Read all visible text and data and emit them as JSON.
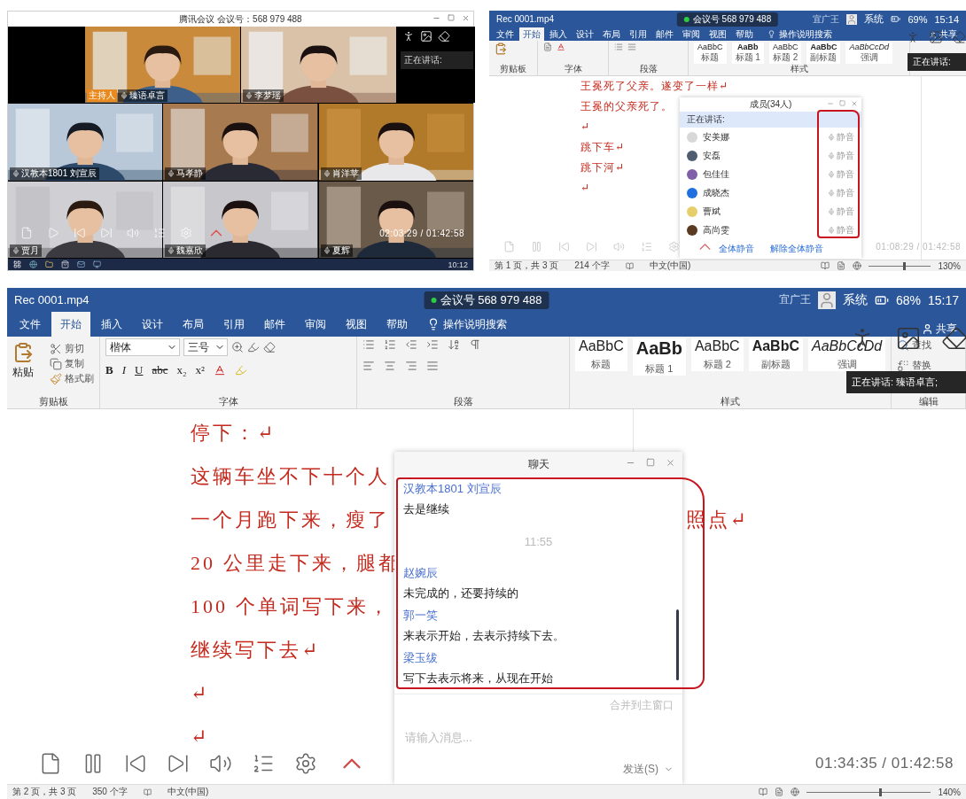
{
  "video_call": {
    "title": "腾讯会议 会议号：568 979 488",
    "side_label": "正在讲话:",
    "tiles": [
      {
        "name": "臻语卓言",
        "host_badge": "主持人"
      },
      {
        "name": "李梦瑶"
      },
      {
        "name": "汉教本1801 刘宣辰"
      },
      {
        "name": "马孝静"
      },
      {
        "name": "肖洋苹"
      },
      {
        "name": "贾月"
      },
      {
        "name": "魏嘉欣"
      },
      {
        "name": "夏辉"
      }
    ],
    "player": {
      "playing": false,
      "time": "02:03:29 / 01:42:58"
    },
    "taskbar_clock": "10:12"
  },
  "word_small": {
    "title_bar": {
      "file": "Rec 0001.mp4",
      "meeting": "会议号 568 979 488",
      "user": "宜广王",
      "system": "系统",
      "battery": "69%",
      "clock": "15:14"
    },
    "tabs": [
      {
        "label": "文件",
        "selected": false
      },
      {
        "label": "开始",
        "selected": true
      },
      {
        "label": "插入",
        "selected": false
      },
      {
        "label": "设计",
        "selected": false
      },
      {
        "label": "布局",
        "selected": false
      },
      {
        "label": "引用",
        "selected": false
      },
      {
        "label": "邮件",
        "selected": false
      },
      {
        "label": "审阅",
        "selected": false
      },
      {
        "label": "视图",
        "selected": false
      },
      {
        "label": "帮助",
        "selected": false
      }
    ],
    "search": "操作说明搜索",
    "share": "共享",
    "ribbon": [
      {
        "kind": "plain",
        "label": "剪贴板"
      },
      {
        "kind": "plain",
        "label": "字体"
      },
      {
        "kind": "plain",
        "label": "段落"
      },
      {
        "kind": "styles",
        "label": "样式",
        "styles": [
          {
            "sample": "AaBbC",
            "name": "标题",
            "kind": "regular"
          },
          {
            "sample": "AaBb",
            "name": "标题 1",
            "kind": "bold"
          },
          {
            "sample": "AaBbC",
            "name": "标题 2",
            "kind": "regular"
          },
          {
            "sample": "AaBbC",
            "name": "副标题",
            "kind": "bold"
          },
          {
            "sample": "AaBbCcDd",
            "name": "强调",
            "kind": "italic"
          }
        ]
      }
    ],
    "tooltip": "正在讲话:",
    "doc_lines": [
      {
        "text": "王冕死了父亲。遂变了一样↵"
      },
      {
        "text": "王冕的父亲死了。"
      },
      {
        "text": "↵"
      },
      {
        "text": "跳下车↵"
      },
      {
        "text": "跳下河↵"
      },
      {
        "text": "↵"
      }
    ],
    "members": {
      "title": "成员(34人)",
      "speaking_label": "正在讲话:",
      "list": [
        {
          "name": "安美娜",
          "status": "静音",
          "color": "#d8d8d8"
        },
        {
          "name": "安磊",
          "status": "静音",
          "color": "#4f5d70"
        },
        {
          "name": "包佳佳",
          "status": "静音",
          "color": "#8060a8"
        },
        {
          "name": "成晓杰",
          "status": "静音",
          "color": "#1f6fe0"
        },
        {
          "name": "曹斌",
          "status": "静音",
          "color": "#e6cf6a"
        },
        {
          "name": "高尚雯",
          "status": "静音",
          "color": "#5a3a20"
        }
      ],
      "buttons": [
        "全体静音",
        "解除全体静音"
      ]
    },
    "player": {
      "playing": true,
      "time": "01:08:29 / 01:42:58"
    },
    "status": {
      "page": "第 1 页，共 3 页",
      "words": "214 个字",
      "language": "中文(中国)",
      "zoom_slider": {
        "level": 0.55
      },
      "zoom": "130%"
    }
  },
  "word_large": {
    "title_bar": {
      "file": "Rec 0001.mp4",
      "meeting": "会议号 568 979 488",
      "user": "宜广王",
      "system": "系统",
      "battery": "68%",
      "clock": "15:17"
    },
    "tabs": [
      {
        "label": "文件",
        "selected": false
      },
      {
        "label": "开始",
        "selected": true
      },
      {
        "label": "插入",
        "selected": false
      },
      {
        "label": "设计",
        "selected": false
      },
      {
        "label": "布局",
        "selected": false
      },
      {
        "label": "引用",
        "selected": false
      },
      {
        "label": "邮件",
        "selected": false
      },
      {
        "label": "审阅",
        "selected": false
      },
      {
        "label": "视图",
        "selected": false
      },
      {
        "label": "帮助",
        "selected": false
      }
    ],
    "search": "操作说明搜索",
    "share": "共享",
    "ribbon": [
      {
        "kind": "clipboard",
        "label": "剪贴板",
        "paste": "粘贴",
        "items": [
          "剪切",
          "复制",
          "格式刷"
        ]
      },
      {
        "kind": "font",
        "label": "字体",
        "font": "楷体",
        "size": "三号",
        "buttons": [
          "B",
          "I",
          "U",
          "abc",
          "x₂",
          "x²"
        ]
      },
      {
        "kind": "paragraph",
        "label": "段落"
      },
      {
        "kind": "styles",
        "label": "样式",
        "styles": [
          {
            "sample": "AaBbC",
            "name": "标题",
            "kind": "regular"
          },
          {
            "sample": "AaBb",
            "name": "标题 1",
            "kind": "bold"
          },
          {
            "sample": "AaBbC",
            "name": "标题 2",
            "kind": "regular"
          },
          {
            "sample": "AaBbC",
            "name": "副标题",
            "kind": "bold"
          },
          {
            "sample": "AaBbCcDd",
            "name": "强调",
            "kind": "italic"
          }
        ]
      },
      {
        "kind": "editing",
        "label": "编辑",
        "items": [
          "查找",
          "替换"
        ]
      }
    ],
    "tooltip": "正在讲话: 臻语卓言;",
    "doc_lines": [
      {
        "text": "停下：↵"
      },
      {
        "text": "这辆车坐不下十个人"
      },
      {
        "text": "一个月跑下来，瘦了",
        "tail": "照点↵"
      },
      {
        "text": "20 公里走下来，腿都"
      },
      {
        "text": "100 个单词写下来，"
      },
      {
        "text": "继续写下去↵"
      },
      {
        "text": "↵"
      },
      {
        "text": "↵"
      }
    ],
    "chat": {
      "title": "聊天",
      "messages": [
        {
          "kind": "message",
          "sender": "汉教本1801 刘宣辰",
          "text": "去是继续"
        },
        {
          "kind": "time",
          "text": "11:55"
        },
        {
          "kind": "message",
          "sender": "赵婉辰",
          "text": "未完成的，还要持续的"
        },
        {
          "kind": "message",
          "sender": "郭一笑",
          "text": "来表示开始，去表示持续下去。"
        },
        {
          "kind": "message",
          "sender": "梁玉绂",
          "text": "写下去表示将来，从现在开始"
        }
      ],
      "merge_link": "合并到主窗口",
      "placeholder": "请输入消息...",
      "send": "发送(S)"
    },
    "player": {
      "playing": true,
      "time": "01:34:35 / 01:42:58"
    },
    "status": {
      "page": "第 2 页，共 3 页",
      "words": "350 个字",
      "language": "中文(中国)",
      "zoom_slider": {
        "level": 0.58
      },
      "zoom": "140%"
    }
  }
}
